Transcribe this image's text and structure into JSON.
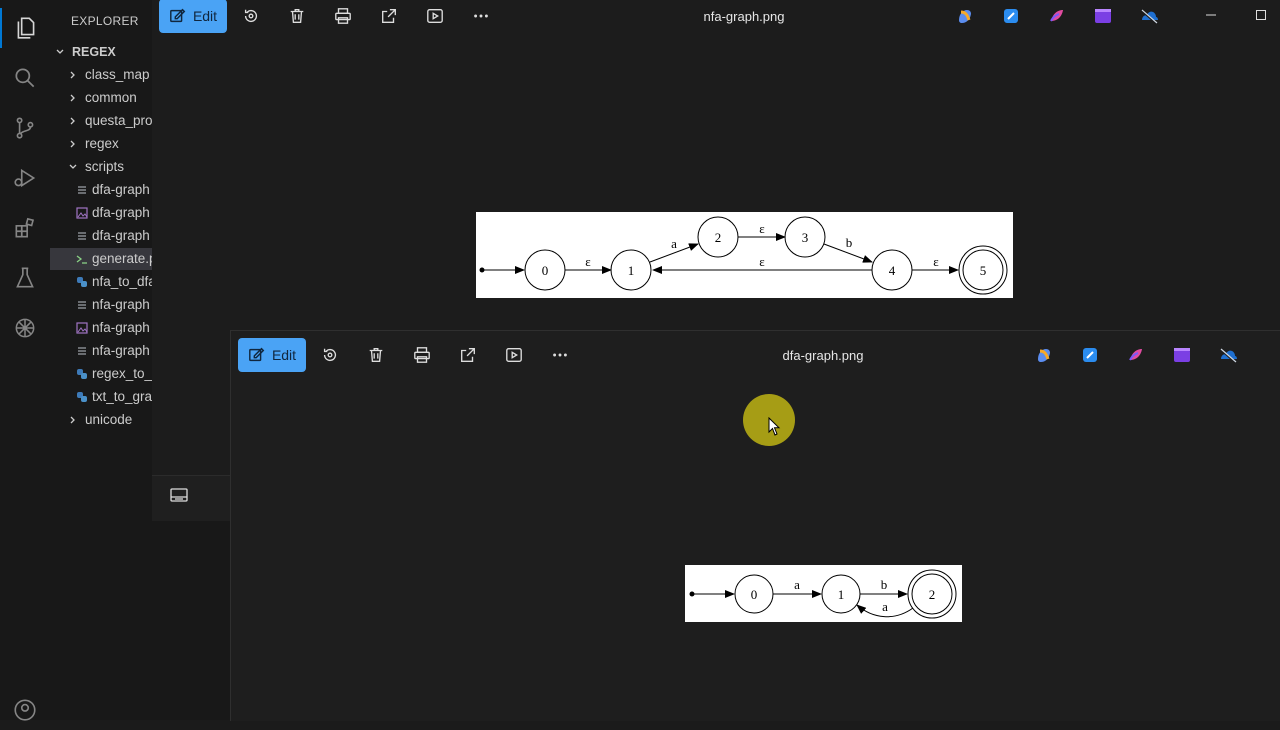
{
  "explorer": {
    "title": "EXPLORER",
    "root": "REGEX",
    "items": [
      {
        "label": "class_map",
        "type": "folder"
      },
      {
        "label": "common",
        "type": "folder"
      },
      {
        "label": "questa_pro",
        "type": "folder"
      },
      {
        "label": "regex",
        "type": "folder"
      },
      {
        "label": "scripts",
        "type": "folder-open"
      },
      {
        "label": "dfa-graph",
        "type": "file"
      },
      {
        "label": "dfa-graph",
        "type": "image"
      },
      {
        "label": "dfa-graph",
        "type": "file"
      },
      {
        "label": "generate.p",
        "type": "shell"
      },
      {
        "label": "nfa_to_dfa",
        "type": "python"
      },
      {
        "label": "nfa-graph",
        "type": "file"
      },
      {
        "label": "nfa-graph",
        "type": "image"
      },
      {
        "label": "nfa-graph",
        "type": "file"
      },
      {
        "label": "regex_to_",
        "type": "python"
      },
      {
        "label": "txt_to_gra",
        "type": "python"
      },
      {
        "label": "unicode",
        "type": "folder"
      }
    ]
  },
  "viewer_back": {
    "edit_label": "Edit",
    "file_title": "nfa-graph.png",
    "graph": {
      "states": [
        "0",
        "1",
        "2",
        "3",
        "4",
        "5"
      ],
      "edge_labels": [
        "ε",
        "a",
        "ε",
        "b",
        "ε",
        "ε"
      ]
    }
  },
  "viewer_front": {
    "edit_label": "Edit",
    "file_title": "dfa-graph.png",
    "graph": {
      "states": [
        "0",
        "1",
        "2"
      ],
      "edge_labels": [
        "a",
        "b",
        "a"
      ]
    }
  },
  "colors": {
    "accent": "#4aa3f5",
    "activity_indicator": "#0078d4",
    "cursor_highlight": "#bdb414"
  }
}
